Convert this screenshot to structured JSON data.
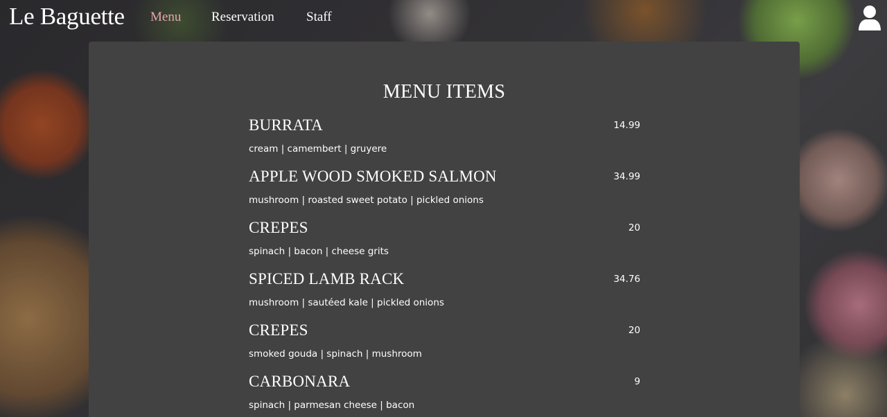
{
  "nav": {
    "brand": "Le Baguette",
    "links": [
      {
        "label": "Menu",
        "active": true
      },
      {
        "label": "Reservation",
        "active": false
      },
      {
        "label": "Staff",
        "active": false
      }
    ],
    "user_icon": "user-icon",
    "active_color": "#e8a3b3"
  },
  "menu": {
    "title": "MENU ITEMS",
    "items": [
      {
        "name": "BURRATA",
        "price": "14.99",
        "description": "cream | camembert | gruyere"
      },
      {
        "name": "APPLE WOOD SMOKED SALMON",
        "price": "34.99",
        "description": "mushroom | roasted sweet potato | pickled onions"
      },
      {
        "name": "CREPES",
        "price": "20",
        "description": "spinach | bacon | cheese grits"
      },
      {
        "name": "SPICED LAMB RACK",
        "price": "34.76",
        "description": "mushroom | sautéed kale | pickled onions"
      },
      {
        "name": "CREPES",
        "price": "20",
        "description": "smoked gouda | spinach | mushroom"
      },
      {
        "name": "CARBONARA",
        "price": "9",
        "description": "spinach | parmesan cheese | bacon"
      }
    ]
  },
  "colors": {
    "panel": "#424242",
    "text": "#ffffff"
  }
}
